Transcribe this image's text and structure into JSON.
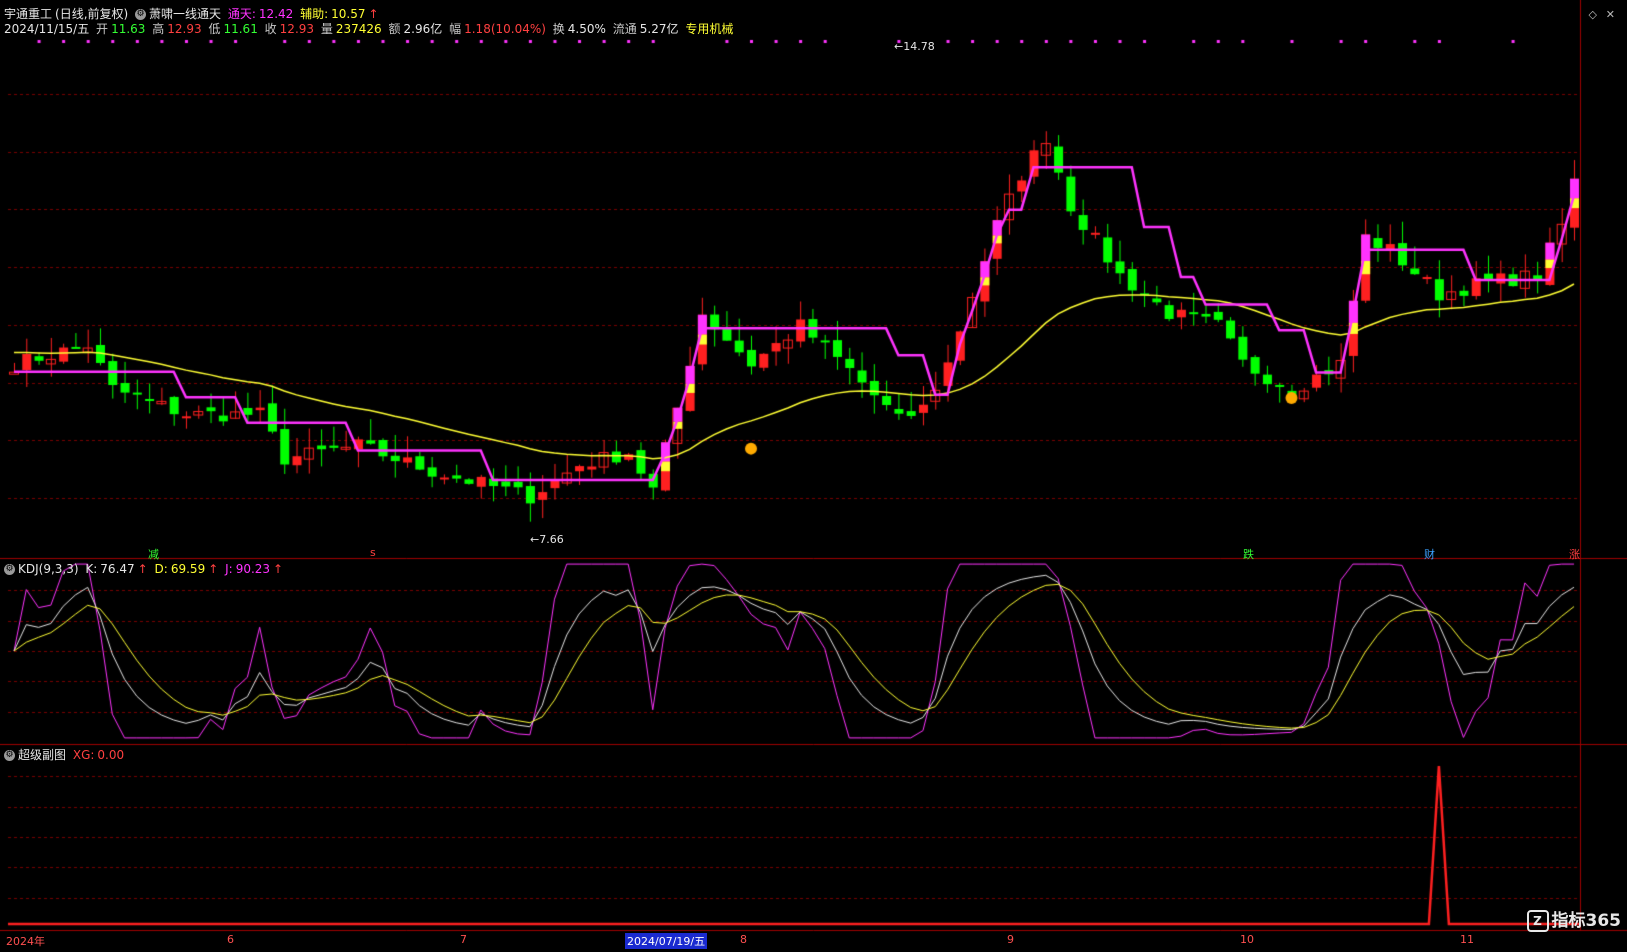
{
  "header": {
    "stock_name": "宇通重工",
    "period": "(日线,前复权)",
    "indicator_name": "萧啸一线通天",
    "tongtian_label": "通天:",
    "tongtian_value": "12.42",
    "fuzhu_label": "辅助:",
    "fuzhu_value": "10.57",
    "fuzhu_arrow": "↑"
  },
  "quote": {
    "date": "2024/11/15/五",
    "open_label": "开",
    "open": "11.63",
    "high_label": "高",
    "high": "12.93",
    "low_label": "低",
    "low": "11.61",
    "close_label": "收",
    "close": "12.93",
    "volume_label": "量",
    "volume": "237426",
    "amount_label": "额",
    "amount": "2.96亿",
    "change_label": "幅",
    "change": "1.18(10.04%)",
    "turnover_label": "换",
    "turnover": "4.50%",
    "float_label": "流通",
    "float": "5.27亿",
    "sector": "专用机械"
  },
  "price_panel": {
    "high_marker": "14.78",
    "low_marker": "7.66",
    "signals": [
      {
        "text": "减",
        "color": "#33ff33"
      },
      {
        "text": "s",
        "color": "#ff4040"
      },
      {
        "text": "跌",
        "color": "#33ff33"
      },
      {
        "text": "财",
        "color": "#3aa0ff"
      },
      {
        "text": "涨",
        "color": "#ff4040"
      }
    ]
  },
  "kdj_panel": {
    "name": "KDJ(9,3,3)",
    "k_label": "K:",
    "k": "76.47",
    "k_arrow": "↑",
    "d_label": "D:",
    "d": "69.59",
    "d_arrow": "↑",
    "j_label": "J:",
    "j": "90.23",
    "j_arrow": "↑"
  },
  "sub_panel": {
    "name": "超级副图",
    "xg_label": "XG:",
    "xg": "0.00"
  },
  "x_axis": {
    "labels": [
      "2024年",
      "6",
      "7",
      "2024/07/19/五",
      "8",
      "9",
      "10",
      "11"
    ]
  },
  "brand": {
    "logo": "Z",
    "text": "指标365"
  },
  "colors": {
    "background": "#000000",
    "up": "#ff2020",
    "down": "#00ff00",
    "tongtian": "#ff33ff",
    "ma": "#ffff33",
    "grid": "#7a0000",
    "kdj_k": "#e6e6e6",
    "kdj_d": "#ffff33",
    "kdj_j": "#ff33ff",
    "xg": "#ff2020"
  }
}
